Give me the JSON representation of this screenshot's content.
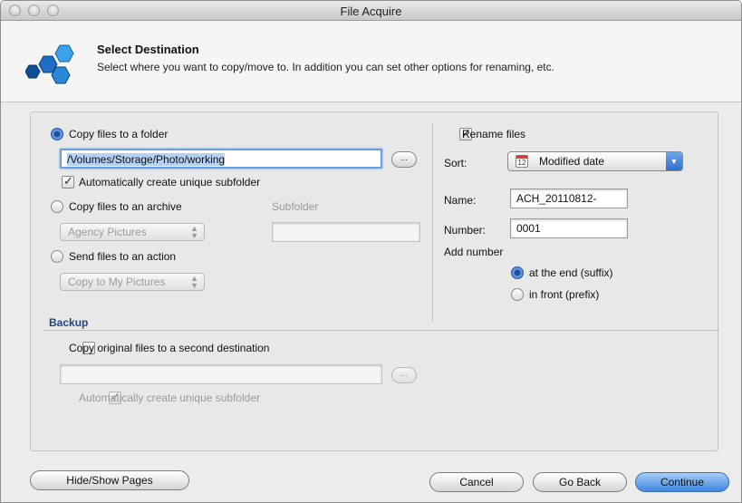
{
  "window": {
    "title": "File Acquire"
  },
  "header": {
    "title": "Select Destination",
    "subtitle": "Select where you want to copy/move to. In addition you can set other options for renaming, etc."
  },
  "destination": {
    "copy_folder_label": "Copy files to a folder",
    "folder_path": "/Volumes/Storage/Photo/working",
    "browse_label": "...",
    "auto_subfolder_label": "Automatically create unique subfolder",
    "copy_archive_label": "Copy files to an archive",
    "archive_option": "Agency Pictures",
    "subfolder_label": "Subfolder",
    "send_action_label": "Send files to an action",
    "action_option": "Copy to My Pictures"
  },
  "rename": {
    "rename_label": "Rename files",
    "sort_label": "Sort:",
    "sort_value": "Modified date",
    "sort_icon_text": "12",
    "name_label": "Name:",
    "name_value": "ACH_20110812-",
    "number_label": "Number:",
    "number_value": "0001",
    "add_number_label": "Add number",
    "suffix_label": "at the end (suffix)",
    "prefix_label": "in front (prefix)"
  },
  "backup": {
    "title": "Backup",
    "copy_second_label": "Copy original files to a second destination",
    "browse_label": "...",
    "auto_subfolder_label": "Automatically create unique subfolder"
  },
  "footer": {
    "hide_show_label": "Hide/Show Pages",
    "cancel_label": "Cancel",
    "go_back_label": "Go Back",
    "continue_label": "Continue"
  },
  "colors": {
    "accent": "#3b78d6",
    "section_title": "#26467a",
    "window_bg": "#ececec"
  }
}
